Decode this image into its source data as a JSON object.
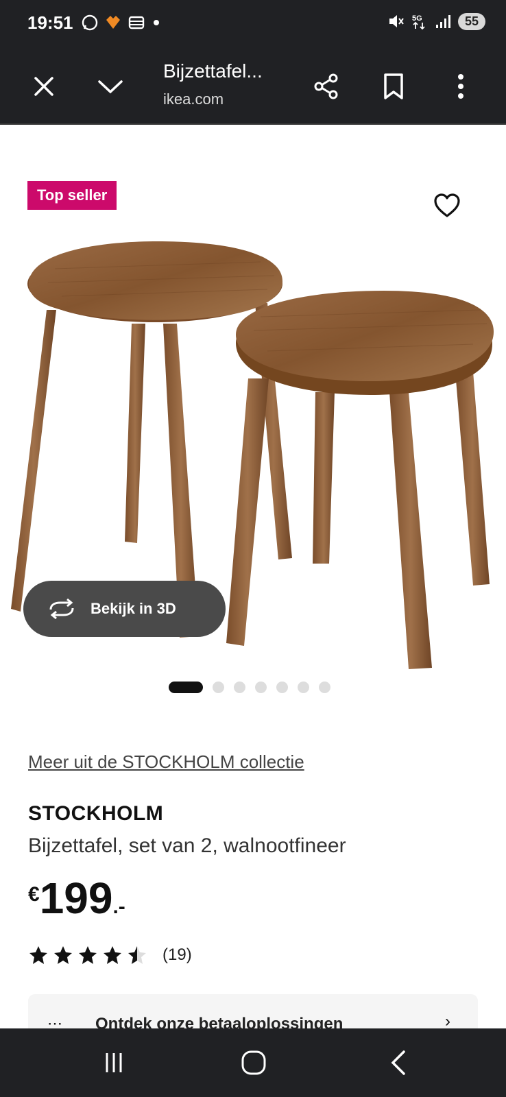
{
  "status_bar": {
    "time": "19:51",
    "left_icons": [
      "whatsapp-icon",
      "app-icon",
      "stack-icon",
      "dot-icon"
    ],
    "right_icons": [
      "mute-icon",
      "5g-icon",
      "signal-icon"
    ],
    "battery": "55"
  },
  "toolbar": {
    "title": "Bijzettafel...",
    "url": "ikea.com"
  },
  "product": {
    "badge": "Top seller",
    "button_3d": "Bekijk in 3D",
    "dots_total": 7,
    "dots_active": 1,
    "collection_link": "Meer uit de STOCKHOLM collectie",
    "name": "STOCKHOLM",
    "description": "Bijzettafel, set van 2, walnootfineer",
    "price_currency": "€",
    "price_amount": "199",
    "price_decimals": ".-",
    "rating_value": 4.5,
    "rating_count": "(19)",
    "payment_text": "Ontdek onze betaaloplossingen"
  },
  "colors": {
    "badge": "#cc0a6b",
    "chat": "#ffda1a",
    "chrome": "#202124",
    "wood": "#8a5a35"
  }
}
